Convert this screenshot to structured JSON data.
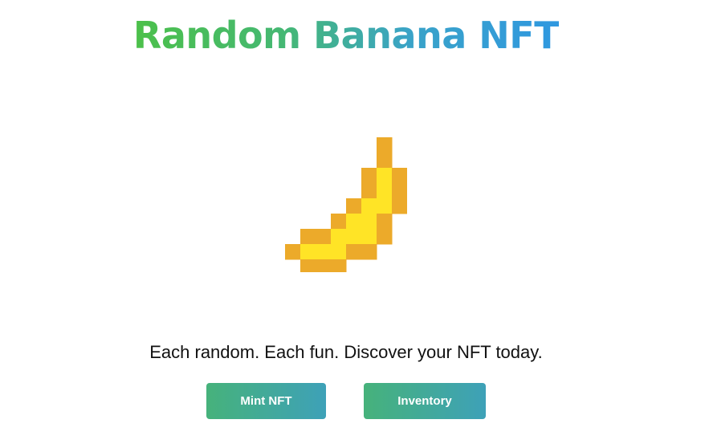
{
  "header": {
    "title": "Random Banana NFT"
  },
  "hero": {
    "image_icon": "pixel-banana-icon",
    "colors": {
      "outline": "#ecaa2a",
      "fill": "#ffe426"
    }
  },
  "tagline": "Each random. Each fun. Discover your NFT today.",
  "actions": {
    "mint_label": "Mint NFT",
    "inventory_label": "Inventory"
  },
  "theme": {
    "gradient_start": "#4cc04a",
    "gradient_end": "#2f98e0"
  }
}
